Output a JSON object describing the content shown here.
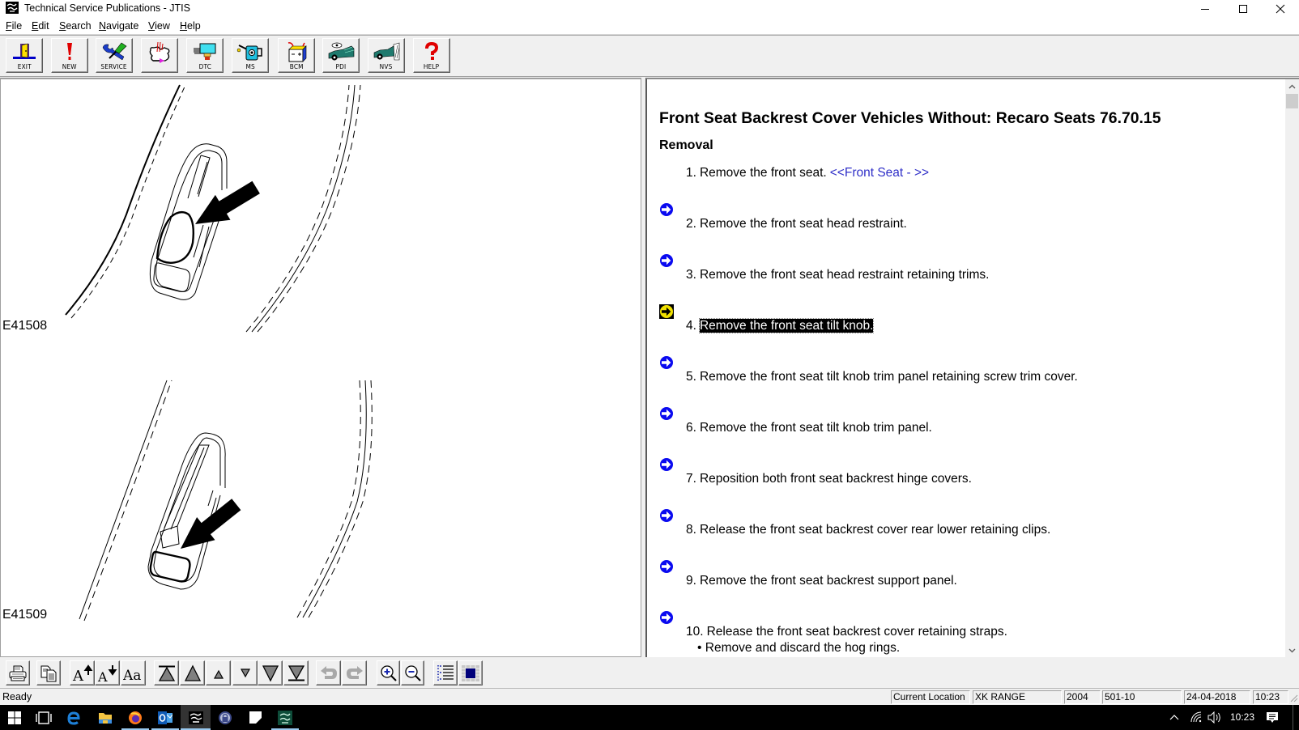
{
  "window": {
    "title": "Technical Service Publications - JTIS",
    "app_icon": "jtis-app-icon",
    "controls": [
      "minimize-icon",
      "maximize-icon",
      "close-icon"
    ]
  },
  "menu": [
    {
      "accel": "F",
      "rest": "ile"
    },
    {
      "accel": "E",
      "rest": "dit"
    },
    {
      "accel": "S",
      "rest": "earch"
    },
    {
      "accel": "N",
      "rest": "avigate"
    },
    {
      "accel": "V",
      "rest": "iew"
    },
    {
      "accel": "H",
      "rest": "elp"
    }
  ],
  "toolbar": [
    {
      "label": "EXIT",
      "icon": "exit-door-icon"
    },
    {
      "label": "NEW",
      "icon": "exclamation-icon"
    },
    {
      "label": "SERVICE",
      "icon": "wrench-screwdriver-icon"
    },
    {
      "label": "",
      "icon": "wiring-diagram-icon"
    },
    {
      "label": "DTC",
      "icon": "dtc-monitor-icon"
    },
    {
      "label": "MS",
      "icon": "oil-can-icon"
    },
    {
      "label": "BCM",
      "icon": "battery-icon"
    },
    {
      "label": "PDI",
      "icon": "car-inspection-icon"
    },
    {
      "label": "NVS",
      "icon": "car-ramp-icon"
    },
    {
      "label": "HELP",
      "icon": "question-mark-icon"
    }
  ],
  "figures": [
    {
      "label": "E41508"
    },
    {
      "label": "E41509"
    }
  ],
  "document": {
    "title": "Front Seat Backrest Cover Vehicles Without: Recaro Seats 76.70.15",
    "section": "Removal",
    "current_step": 4,
    "steps": [
      {
        "number": "1.",
        "text": "Remove the front seat.",
        "link": "<<Front Seat - >>"
      },
      {
        "number": "2.",
        "text": "Remove the front seat head restraint."
      },
      {
        "number": "3.",
        "text": "Remove the front seat head restraint retaining trims."
      },
      {
        "number": "4.",
        "text": "Remove the front seat tilt knob."
      },
      {
        "number": "5.",
        "text": "Remove the front seat tilt knob trim panel retaining screw trim cover."
      },
      {
        "number": "6.",
        "text": "Remove the front seat tilt knob trim panel."
      },
      {
        "number": "7.",
        "text": "Reposition both front seat backrest hinge covers."
      },
      {
        "number": "8.",
        "text": "Release the front seat backrest cover rear lower retaining clips."
      },
      {
        "number": "9.",
        "text": "Remove the front seat backrest support panel."
      },
      {
        "number": "10.",
        "text": "Release the front seat backrest cover retaining straps.",
        "sub": [
          "Remove and discard the hog rings."
        ]
      }
    ]
  },
  "bottom_toolbar": [
    {
      "icon": "print-icon"
    },
    {
      "icon": "copy-icon"
    },
    {
      "icon": "font-larger-icon"
    },
    {
      "icon": "font-smaller-icon"
    },
    {
      "icon": "font-default-icon"
    },
    {
      "icon": "first-step-icon"
    },
    {
      "icon": "previous-step-icon"
    },
    {
      "icon": "previous-small-icon"
    },
    {
      "icon": "next-small-icon"
    },
    {
      "icon": "next-step-icon"
    },
    {
      "icon": "last-step-icon"
    },
    {
      "icon": "back-icon",
      "enabled": false
    },
    {
      "icon": "forward-icon",
      "enabled": false
    },
    {
      "icon": "zoom-in-icon"
    },
    {
      "icon": "zoom-out-icon"
    },
    {
      "icon": "list-view-icon"
    },
    {
      "icon": "fit-view-icon"
    }
  ],
  "status": {
    "text": "Ready",
    "fields": {
      "location_label": "Current Location",
      "model": "XK RANGE",
      "year": "2004",
      "section_code": "501-10",
      "date": "24-04-2018",
      "time": "10:23"
    }
  },
  "taskbar": {
    "apps": [
      "start-icon",
      "task-view-icon",
      "edge-icon",
      "file-explorer-icon",
      "firefox-icon",
      "outlook-icon",
      "jtis-icon",
      "vpn-lock-icon",
      "app-icon",
      "jaguar-tool-icon"
    ],
    "active_app": "jtis-icon",
    "clock": "10:23"
  },
  "colors": {
    "link": "#3030c8",
    "step_arrow": "#0a0af0",
    "current_step_arrow": "#f0e000",
    "highlight_bg": "#000000",
    "highlight_fg": "#ffffff",
    "chrome_bg": "#f0f0f0",
    "taskbar_bg": "#000000"
  }
}
